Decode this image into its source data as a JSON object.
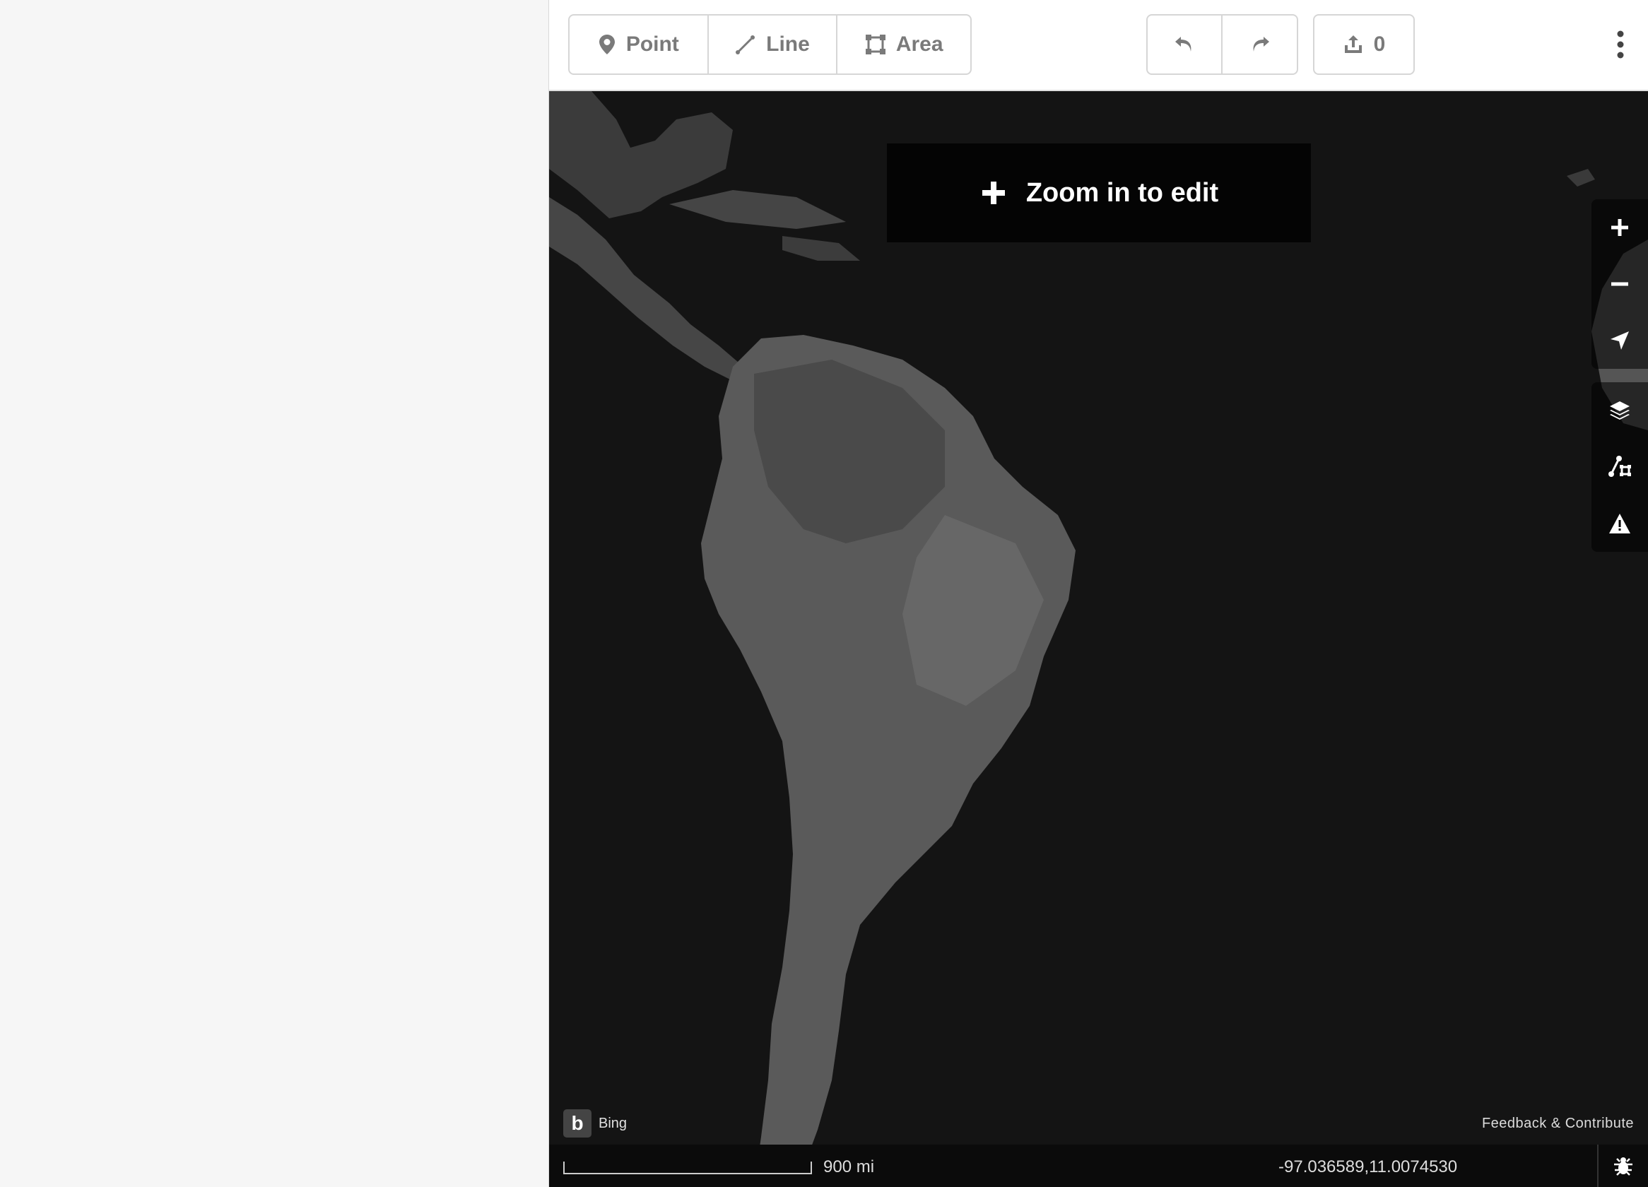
{
  "toolbar": {
    "modes": [
      {
        "label": "Point",
        "icon": "map-pin-icon"
      },
      {
        "label": "Line",
        "icon": "line-icon"
      },
      {
        "label": "Area",
        "icon": "area-icon"
      }
    ],
    "undo_icon": "undo-icon",
    "redo_icon": "redo-icon",
    "save_count": "0",
    "menu_icon": "more-vertical-icon"
  },
  "map": {
    "zoom_banner": "Zoom in to edit",
    "controls": [
      "zoom-in-icon",
      "zoom-out-icon",
      "geolocate-icon",
      "layers-icon",
      "map-data-icon",
      "issues-icon"
    ],
    "attribution": "Bing",
    "feedback": "Feedback & Contribute",
    "scale_label": "900 mi",
    "coordinates": "-97.036589,11.0074530"
  },
  "colors": {
    "map_bg": "#141414",
    "sidebar_bg": "#f6f6f6",
    "button_text": "#7a7a7a"
  }
}
